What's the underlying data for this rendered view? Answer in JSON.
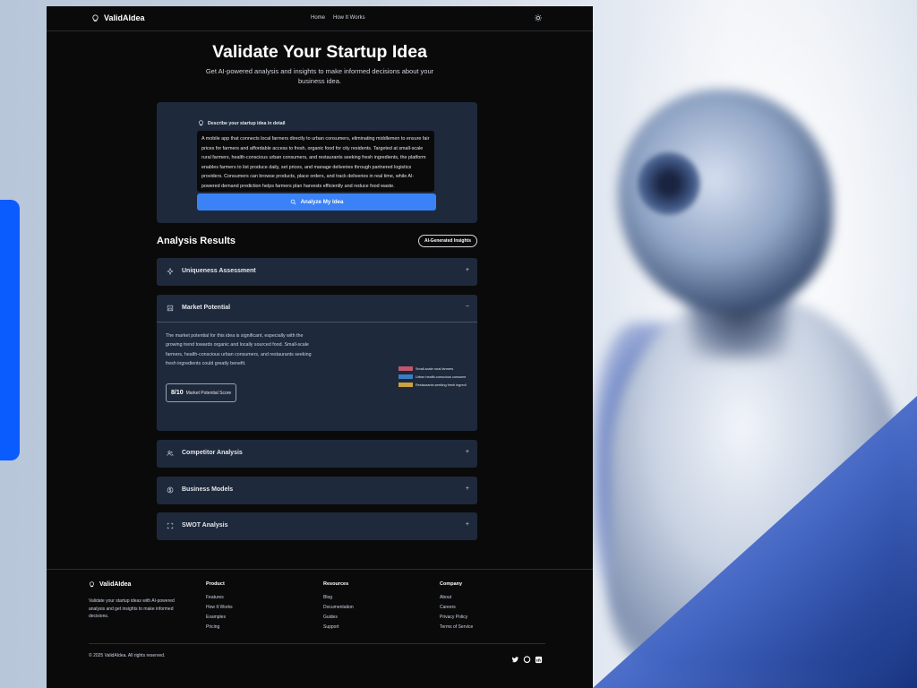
{
  "nav": {
    "brand": "ValidAIdea",
    "links": [
      "Home",
      "How It Works"
    ]
  },
  "hero": {
    "title": "Validate Your Startup Idea",
    "subtitle": "Get AI-powered analysis and insights to make informed decisions about your business idea."
  },
  "input": {
    "label": "Describe your startup idea in detail",
    "value": "A mobile app that connects local farmers directly to urban consumers, eliminating middlemen to ensure fair prices for farmers and affordable access to fresh, organic food for city residents. Targeted at small-scale rural farmers, health-conscious urban consumers, and restaurants seeking fresh ingredients, the platform enables farmers to list produce daily, set prices, and manage deliveries through partnered logistics providers. Consumers can browse products, place orders, and track deliveries in real time, while AI-powered demand prediction helps farmers plan harvests efficiently and reduce food waste.",
    "button": "Analyze My Idea"
  },
  "results": {
    "title": "Analysis Results",
    "badge": "AI-Generated Insights",
    "sections": [
      {
        "title": "Uniqueness Assessment",
        "toggle": "+"
      },
      {
        "title": "Market Potential",
        "toggle": "−"
      },
      {
        "title": "Competitor Analysis",
        "toggle": "+"
      },
      {
        "title": "Business Models",
        "toggle": "+"
      },
      {
        "title": "SWOT Analysis",
        "toggle": "+"
      }
    ],
    "market": {
      "text": "The market potential for this idea is significant, especially with the growing trend towards organic and locally sourced food. Small-scale farmers, health-conscious urban consumers, and restaurants seeking fresh ingredients could greatly benefit.",
      "score": "8/10",
      "score_label": "Market Potential Score",
      "legend": [
        {
          "label": "Small-scale rural farmers",
          "color": "#c2566c"
        },
        {
          "label": "Urban health-conscious consume",
          "color": "#3b7dc4"
        },
        {
          "label": "Restaurants seeking fresh ingredi",
          "color": "#c9a33f"
        }
      ]
    }
  },
  "footer": {
    "brand": "ValidAIdea",
    "desc": "Validate your startup ideas with AI-powered analysis and get insights to make informed decisions.",
    "cols": [
      {
        "head": "Product",
        "items": [
          "Features",
          "How It Works",
          "Examples",
          "Pricing"
        ]
      },
      {
        "head": "Resources",
        "items": [
          "Blog",
          "Documentation",
          "Guides",
          "Support"
        ]
      },
      {
        "head": "Company",
        "items": [
          "About",
          "Careers",
          "Privacy Policy",
          "Terms of Service"
        ]
      }
    ],
    "copyright": "© 2025 ValidAIdea. All rights reserved.",
    "social": [
      "twitter-icon",
      "github-icon",
      "linkedin-icon"
    ]
  },
  "colors": {
    "accent": "#3b82f6",
    "panel": "#1e293b",
    "page": "#0a0a0b",
    "side_bar": "#0a5cff"
  }
}
